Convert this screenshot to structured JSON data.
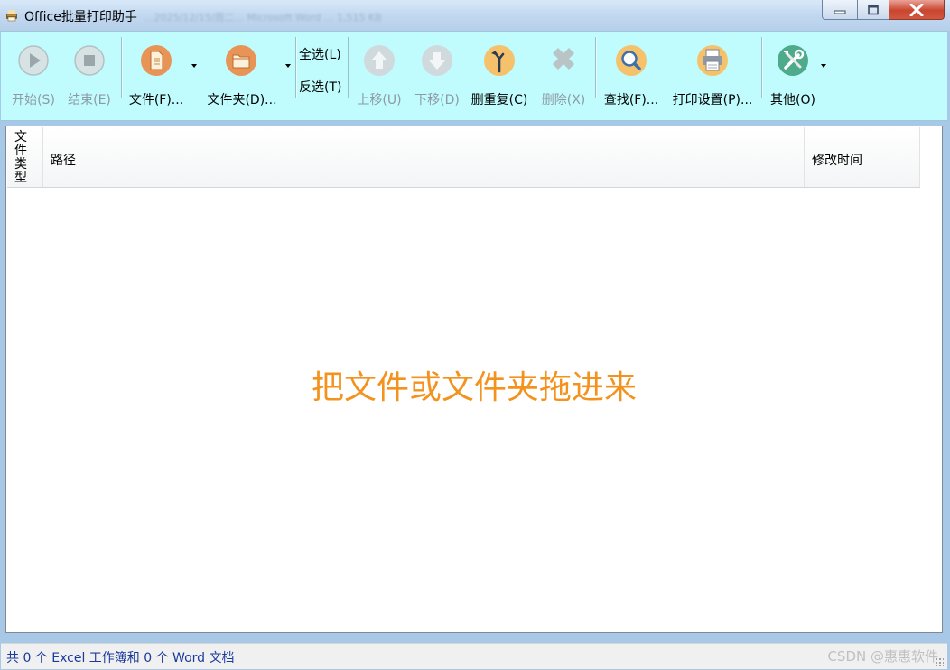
{
  "window": {
    "title": "Office批量打印助手",
    "title_blurred": "...2025/12/15/周二...    Microsoft Word ...    1,515 KB"
  },
  "toolbar": {
    "start_label": "开始(S)",
    "stop_label": "结束(E)",
    "file_label": "文件(F)...",
    "folder_label": "文件夹(D)...",
    "select_all_label": "全选(L)",
    "invert_label": "反选(T)",
    "move_up_label": "上移(U)",
    "move_down_label": "下移(D)",
    "dedupe_label": "删重复(C)",
    "delete_label": "删除(X)",
    "find_label": "查找(F)...",
    "print_settings_label": "打印设置(P)...",
    "other_label": "其他(O)"
  },
  "list": {
    "columns": {
      "type": "文件类型",
      "path": "路径",
      "modified": "修改时间"
    },
    "drop_hint": "把文件或文件夹拖进来"
  },
  "status": {
    "summary": "共 0 个 Excel 工作簿和 0 个 Word 文档",
    "watermark": "CSDN @惠惠软件"
  },
  "colors": {
    "toolbar_bg": "#c0fbfd",
    "drop_hint": "#f3921c",
    "status_text": "#1a3a9e",
    "close_button": "#c9452f"
  }
}
